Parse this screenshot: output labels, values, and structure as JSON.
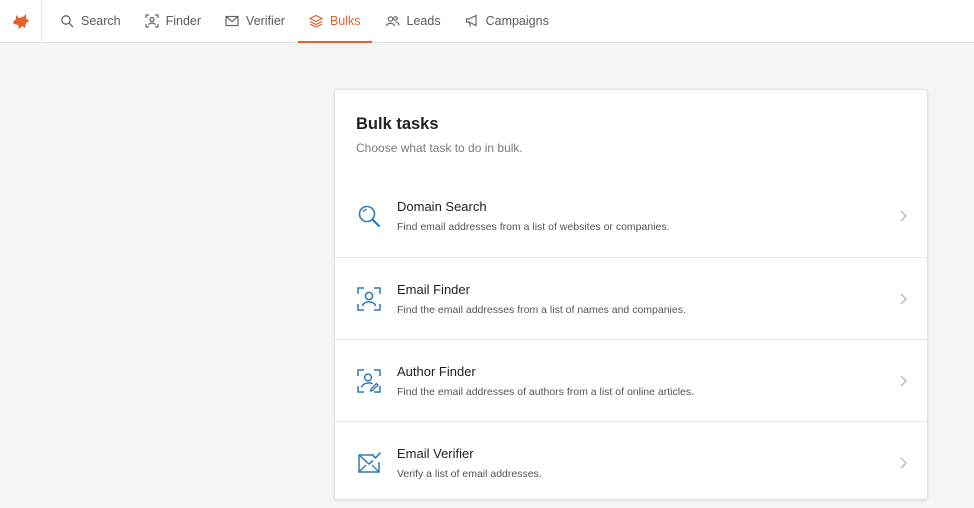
{
  "nav": {
    "items": [
      {
        "label": "Search",
        "icon": "search-icon",
        "active": false
      },
      {
        "label": "Finder",
        "icon": "finder-icon",
        "active": false
      },
      {
        "label": "Verifier",
        "icon": "verifier-icon",
        "active": false
      },
      {
        "label": "Bulks",
        "icon": "layers-icon",
        "active": true
      },
      {
        "label": "Leads",
        "icon": "users-icon",
        "active": false
      },
      {
        "label": "Campaigns",
        "icon": "megaphone-icon",
        "active": false
      }
    ]
  },
  "colors": {
    "accent": "#e5602c",
    "icon_blue": "#2c7ab8"
  },
  "card": {
    "title": "Bulk tasks",
    "subtitle": "Choose what task to do in bulk.",
    "tasks": [
      {
        "title": "Domain Search",
        "desc": "Find email addresses from a list of websites or companies.",
        "icon": "search-icon"
      },
      {
        "title": "Email Finder",
        "desc": "Find the email addresses from a list of names and companies.",
        "icon": "person-frame-icon"
      },
      {
        "title": "Author Finder",
        "desc": "Find the email addresses of authors from a list of online articles.",
        "icon": "author-frame-icon"
      },
      {
        "title": "Email Verifier",
        "desc": "Verify a list of email addresses.",
        "icon": "email-check-icon"
      }
    ]
  }
}
